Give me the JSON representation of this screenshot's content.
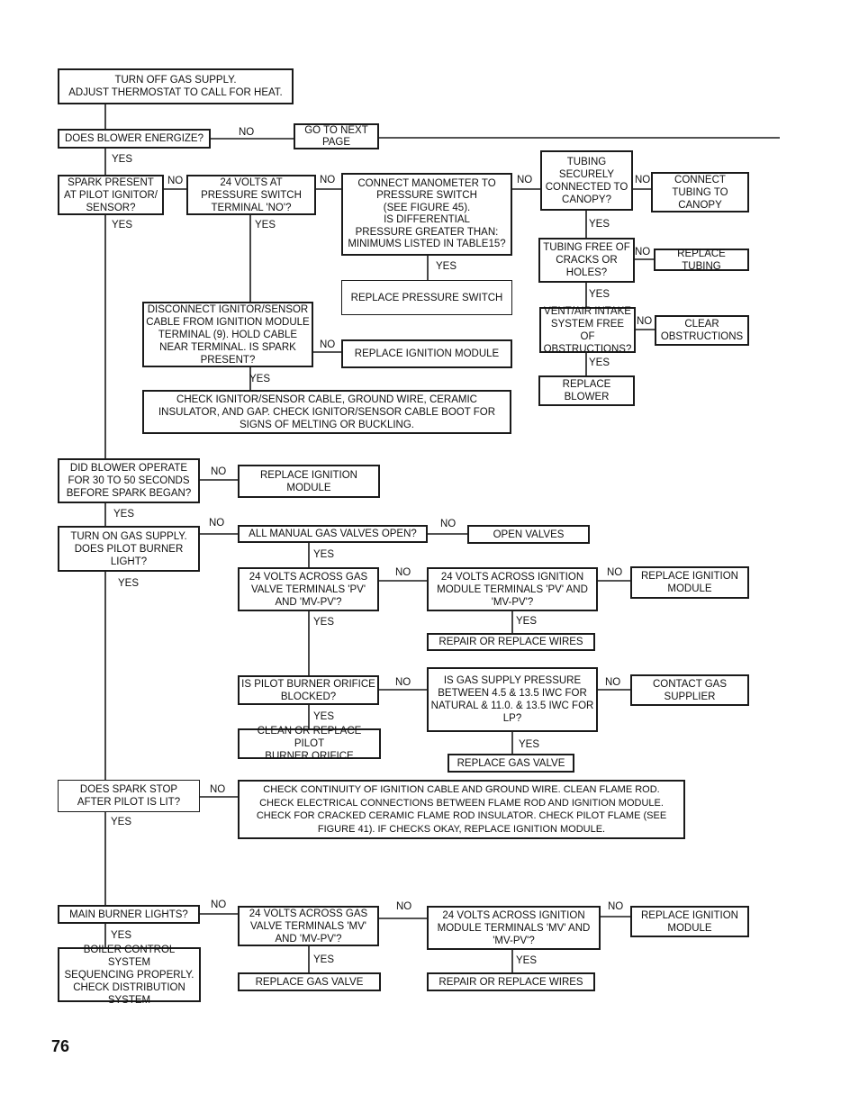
{
  "page_number": "76",
  "nodes": {
    "start": "TURN OFF GAS SUPPLY.\nADJUST THERMOSTAT TO CALL FOR HEAT.",
    "blower_energize": "DOES BLOWER ENERGIZE?",
    "next_page": "GO TO NEXT\nPAGE",
    "spark_present": "SPARK PRESENT\nAT PILOT IGNITOR/\nSENSOR?",
    "volts_pressure_switch": "24 VOLTS AT\nPRESSURE SWITCH\nTERMINAL 'NO'?",
    "manometer": "CONNECT MANOMETER TO\nPRESSURE SWITCH\n(SEE FIGURE 45).\nIS DIFFERENTIAL\nPRESSURE GREATER THAN:\nMINIMUMS LISTED IN TABLE15?",
    "tubing_secure": "TUBING\nSECURELY\nCONNECTED TO\nCANOPY?",
    "connect_tubing": "CONNECT\nTUBING TO\nCANOPY",
    "tubing_free": "TUBING FREE OF\nCRACKS OR\nHOLES?",
    "replace_tubing": "REPLACE TUBING",
    "replace_pressure_switch": "REPLACE PRESSURE SWITCH",
    "vent_free": "VENT/AIR INTAKE\nSYSTEM FREE OF\nOBSTRUCTIONS?",
    "clear_obstructions": "CLEAR\nOBSTRUCTIONS",
    "replace_blower": "REPLACE\nBLOWER",
    "disconnect_cable": "DISCONNECT IGNITOR/SENSOR\nCABLE FROM IGNITION MODULE\nTERMINAL (9). HOLD CABLE\nNEAR TERMINAL. IS SPARK\nPRESENT?",
    "replace_ignition_module_1": "REPLACE IGNITION MODULE",
    "check_cable": "CHECK IGNITOR/SENSOR CABLE, GROUND WIRE, CERAMIC\nINSULATOR, AND GAP. CHECK IGNITOR/SENSOR CABLE BOOT FOR\nSIGNS OF MELTING OR BUCKLING.",
    "blower_30_50": "DID BLOWER OPERATE\nFOR 30 TO 50 SECONDS\nBEFORE SPARK BEGAN?",
    "replace_ignition_module_2": "REPLACE IGNITION\nMODULE",
    "turn_on_gas": "TURN ON GAS SUPPLY.\nDOES PILOT BURNER\nLIGHT?",
    "manual_valves": "ALL MANUAL GAS VALVES OPEN?",
    "open_valves": "OPEN VALVES",
    "volts_gas_valve_pv": "24 VOLTS ACROSS GAS\nVALVE TERMINALS 'PV'\nAND 'MV-PV'?",
    "volts_module_pv": "24 VOLTS ACROSS IGNITION\nMODULE TERMINALS 'PV' AND\n'MV-PV'?",
    "replace_ignition_module_3": "REPLACE IGNITION\nMODULE",
    "repair_wires_1": "REPAIR OR REPLACE WIRES",
    "orifice_blocked": "IS PILOT BURNER ORIFICE\nBLOCKED?",
    "gas_pressure": "IS GAS SUPPLY PRESSURE\nBETWEEN 4.5 & 13.5 IWC FOR\nNATURAL & 11.0. & 13.5 IWC FOR\nLP?",
    "contact_supplier": "CONTACT GAS\nSUPPLIER",
    "clean_orifice": "CLEAN OR REPLACE PILOT\nBURNER ORIFICE",
    "replace_gas_valve_1": "REPLACE GAS VALVE",
    "spark_stop": "DOES SPARK STOP\nAFTER PILOT IS LIT?",
    "check_continuity": "CHECK CONTINUITY OF IGNITION CABLE AND GROUND WIRE. CLEAN FLAME ROD.\nCHECK ELECTRICAL CONNECTIONS BETWEEN FLAME ROD AND IGNITION MODULE.\nCHECK FOR CRACKED CERAMIC FLAME ROD INSULATOR. CHECK PILOT FLAME (SEE\nFIGURE 41). IF CHECKS OKAY, REPLACE IGNITION MODULE.",
    "main_burner": "MAIN BURNER LIGHTS?",
    "boiler_ok": "BOILER CONTROL SYSTEM\nSEQUENCING PROPERLY.\nCHECK DISTRIBUTION\nSYSTEM",
    "volts_gas_valve_mv": "24 VOLTS ACROSS GAS\nVALVE TERMINALS 'MV'\nAND 'MV-PV'?",
    "replace_gas_valve_2": "REPLACE GAS VALVE",
    "volts_module_mv": "24 VOLTS ACROSS IGNITION\nMODULE TERMINALS 'MV' AND\n'MV-PV'?",
    "replace_ignition_module_4": "REPLACE IGNITION\nMODULE",
    "repair_wires_2": "REPAIR OR REPLACE WIRES"
  },
  "labels": {
    "yes": "YES",
    "no": "NO"
  }
}
